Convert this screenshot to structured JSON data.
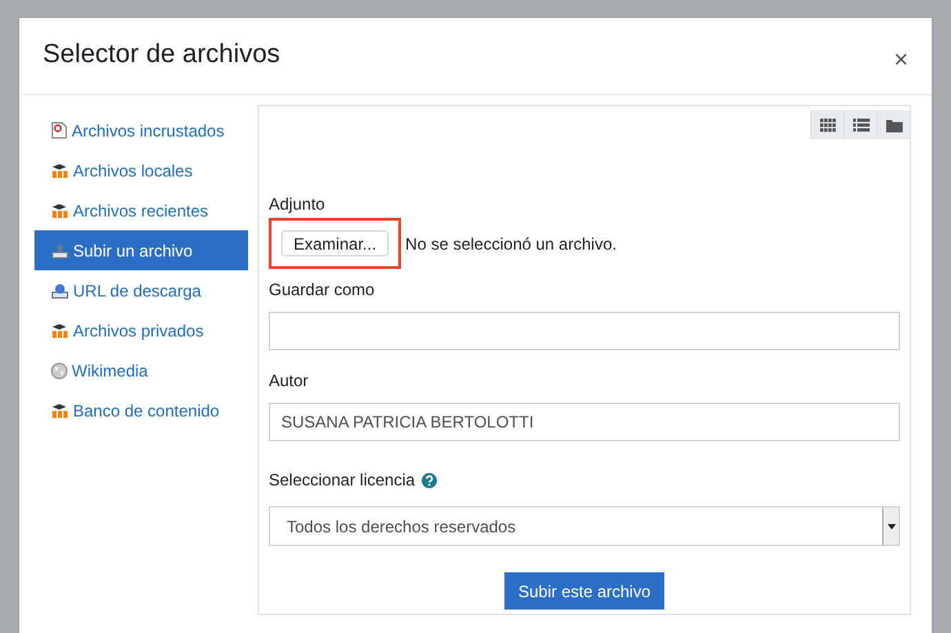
{
  "dialog": {
    "title": "Selector de archivos",
    "close": "×"
  },
  "sidebar": {
    "items": [
      {
        "label": "Archivos incrustados",
        "kind": "embedded",
        "selected": false
      },
      {
        "label": "Archivos locales",
        "kind": "moodle",
        "selected": false
      },
      {
        "label": "Archivos recientes",
        "kind": "moodle",
        "selected": false
      },
      {
        "label": "Subir un archivo",
        "kind": "upload",
        "selected": true
      },
      {
        "label": "URL de descarga",
        "kind": "url",
        "selected": false
      },
      {
        "label": "Archivos privados",
        "kind": "moodle",
        "selected": false
      },
      {
        "label": "Wikimedia",
        "kind": "wiki",
        "selected": false
      },
      {
        "label": "Banco de contenido",
        "kind": "moodle",
        "selected": false
      }
    ]
  },
  "view_buttons": [
    {
      "kind": "grid"
    },
    {
      "kind": "list"
    },
    {
      "kind": "folder"
    }
  ],
  "form": {
    "attachment_label": "Adjunto",
    "browse_button": "Examinar...",
    "no_file": "No se seleccionó un archivo.",
    "highlighted": true,
    "save_as_label": "Guardar como",
    "author_label": "Autor",
    "author_value": "SUSANA PATRICIA BERTOLOTTI",
    "license_label": "Seleccionar licencia",
    "license_value": "Todos los derechos reservados",
    "submit": "Subir este archivo"
  }
}
